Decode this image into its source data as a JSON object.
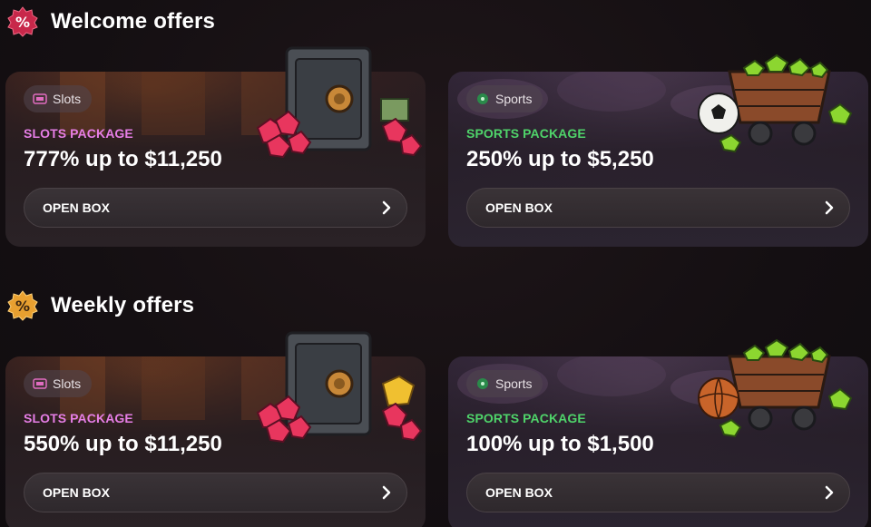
{
  "sections": [
    {
      "title": "Welcome offers",
      "badge_text": "%",
      "badge_color": "#c8284a",
      "cards": [
        {
          "kind": "slots",
          "chip_label": "Slots",
          "chip_icon": "slot-machine-icon",
          "package_label": "SLOTS PACKAGE",
          "offer": "777% up to $11,250",
          "button_label": "OPEN BOX",
          "art": "safe-with-gems-and-cash"
        },
        {
          "kind": "sports",
          "chip_label": "Sports",
          "chip_icon": "sports-ball-icon",
          "package_label": "SPORTS PACKAGE",
          "offer": "250% up to $5,250",
          "button_label": "OPEN BOX",
          "art": "mine-cart-with-soccer-ball"
        }
      ]
    },
    {
      "title": "Weekly offers",
      "badge_text": "%",
      "badge_color": "#e8a030",
      "cards": [
        {
          "kind": "slots",
          "chip_label": "Slots",
          "chip_icon": "slot-machine-icon",
          "package_label": "SLOTS PACKAGE",
          "offer": "550% up to $11,250",
          "button_label": "OPEN BOX",
          "art": "safe-with-gems-and-gold"
        },
        {
          "kind": "sports",
          "chip_label": "Sports",
          "chip_icon": "sports-ball-icon",
          "package_label": "SPORTS PACKAGE",
          "offer": "100% up to $1,500",
          "button_label": "OPEN BOX",
          "art": "mine-cart-with-basketball"
        }
      ]
    }
  ],
  "colors": {
    "slots_accent": "#e67ee6",
    "sports_accent": "#4fd46a",
    "gem_pink": "#e8365e",
    "gem_green": "#8cd630"
  }
}
